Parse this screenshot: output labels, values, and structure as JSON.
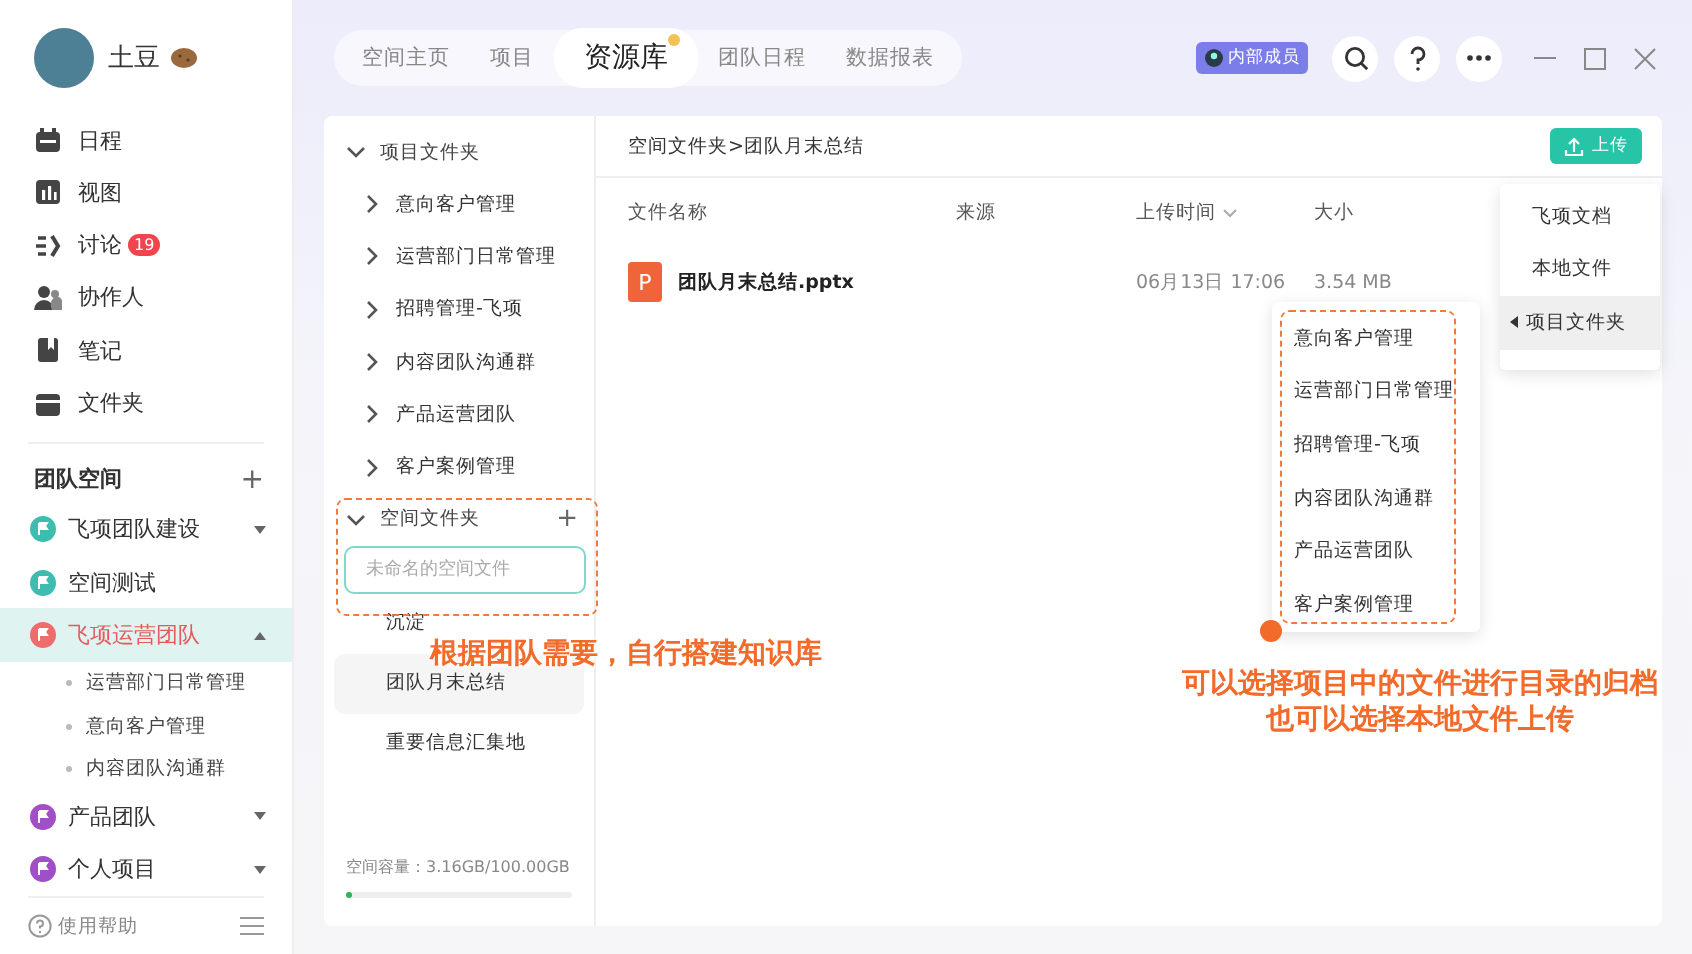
{
  "user": {
    "name": "土豆"
  },
  "nav": [
    {
      "label": "日程",
      "kind": "calendar"
    },
    {
      "label": "视图",
      "kind": "chart"
    },
    {
      "label": "讨论",
      "kind": "discuss",
      "badge": "19"
    },
    {
      "label": "协作人",
      "kind": "people"
    },
    {
      "label": "笔记",
      "kind": "note"
    },
    {
      "label": "文件夹",
      "kind": "folder"
    }
  ],
  "team_space": {
    "title": "团队空间",
    "add": "+",
    "items": [
      {
        "label": "飞项团队建设",
        "color": "#3dbdb0",
        "selected": false,
        "expanded": false
      },
      {
        "label": "空间测试",
        "color": "#3dbdb0",
        "selected": false
      },
      {
        "label": "飞项运营团队",
        "color": "#ee6c6c",
        "selected": true,
        "expanded": true,
        "children": [
          {
            "label": "运营部门日常管理"
          },
          {
            "label": "意向客户管理"
          },
          {
            "label": "内容团队沟通群"
          }
        ]
      },
      {
        "label": "产品团队",
        "color": "#a04fc6",
        "selected": false,
        "expanded": false
      },
      {
        "label": "个人项目",
        "color": "#a04fc6",
        "selected": false,
        "expanded": false
      }
    ]
  },
  "help": {
    "label": "使用帮助"
  },
  "tabs": [
    {
      "label": "空间主页",
      "selected": false
    },
    {
      "label": "项目",
      "selected": false
    },
    {
      "label": "资源库",
      "selected": true,
      "dot": true
    },
    {
      "label": "团队日程",
      "selected": false
    },
    {
      "label": "数据报表",
      "selected": false
    }
  ],
  "member_badge": "内部成员",
  "tree": {
    "project_folder": {
      "label": "项目文件夹",
      "expanded": true,
      "children": [
        {
          "label": "意向客户管理"
        },
        {
          "label": "运营部门日常管理"
        },
        {
          "label": "招聘管理-飞项"
        },
        {
          "label": "内容团队沟通群"
        },
        {
          "label": "产品运营团队"
        },
        {
          "label": "客户案例管理"
        }
      ]
    },
    "space_folder": {
      "label": "空间文件夹",
      "expanded": true,
      "add": "+",
      "new_placeholder": "未命名的空间文件",
      "children": [
        {
          "label": "沉淀",
          "selected": false
        },
        {
          "label": "团队月末总结",
          "selected": true
        },
        {
          "label": "重要信息汇集地",
          "selected": false
        }
      ]
    },
    "storage": {
      "text": "空间容量：3.16GB/100.00GB",
      "level": 0.03
    }
  },
  "files": {
    "breadcrumb": "空间文件夹>团队月末总结",
    "upload": "上传",
    "columns": [
      "文件名称",
      "来源",
      "上传时间",
      "大小"
    ],
    "rows": [
      {
        "icon": "P",
        "name": "团队月末总结.pptx",
        "time": "06月13日 17:06",
        "size": "3.54 MB"
      }
    ]
  },
  "upload_menu": [
    {
      "label": "飞项文档",
      "selected": false
    },
    {
      "label": "本地文件",
      "selected": false
    },
    {
      "label": "项目文件夹",
      "selected": true
    }
  ],
  "project_submenu": [
    "意向客户管理",
    "运营部门日常管理",
    "招聘管理-飞项",
    "内容团队沟通群",
    "产品运营团队",
    "客户案例管理"
  ],
  "annotations": [
    {
      "lines": [
        "根据团队需要，自行搭建知识库"
      ]
    },
    {
      "lines": [
        "可以选择项目中的文件进行目录的归档",
        "也可以选择本地文件上传"
      ]
    }
  ]
}
